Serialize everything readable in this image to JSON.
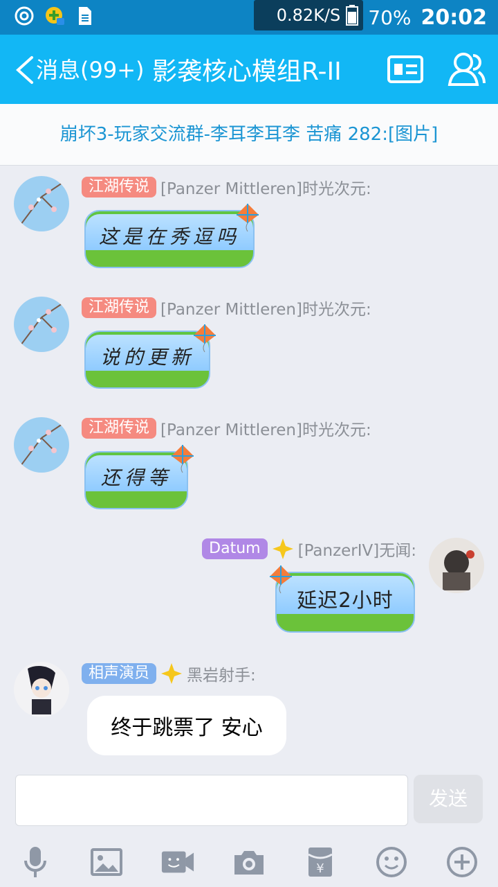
{
  "status_bar": {
    "net_speed": "0.82K/S",
    "battery": "70%",
    "time": "20:02",
    "icons": [
      "netease-icon",
      "game-icon",
      "sim-icon",
      "wifi-icon",
      "signal-icon",
      "battery-icon"
    ]
  },
  "header": {
    "back_label": "消息(99+)",
    "title": "影袭核心模组R-II"
  },
  "notice": {
    "text": "崩坏3-玩家交流群-李耳李耳李   苦痛    282:[图片]"
  },
  "messages": [
    {
      "badge": "江湖传说",
      "sender": "[Panzer Mittleren]时光次元:",
      "text": "这是在秀逗吗"
    },
    {
      "badge": "江湖传说",
      "sender": "[Panzer Mittleren]时光次元:",
      "text": "说的更新"
    },
    {
      "badge": "江湖传说",
      "sender": "[Panzer Mittleren]时光次元:",
      "text": "还得等"
    },
    {
      "badge": "Datum",
      "sender": "[PanzerIV]无闻:",
      "text": "延迟2小时"
    },
    {
      "badge": "相声演员",
      "sender": "黑岩射手:",
      "text": "终于跳票了  安心"
    }
  ],
  "input": {
    "placeholder": "",
    "send_label": "发送"
  },
  "toolbar": [
    "mic-icon",
    "image-icon",
    "video-icon",
    "camera-icon",
    "redpacket-icon",
    "emoji-icon",
    "plus-icon"
  ],
  "colors": {
    "status_bar": "#0d84c4",
    "title_bar": "#12b7f5",
    "notice_text": "#1b95d3",
    "badge_red": "#f58a80",
    "badge_purple": "#b088e6",
    "badge_blue": "#7fb0ee"
  }
}
